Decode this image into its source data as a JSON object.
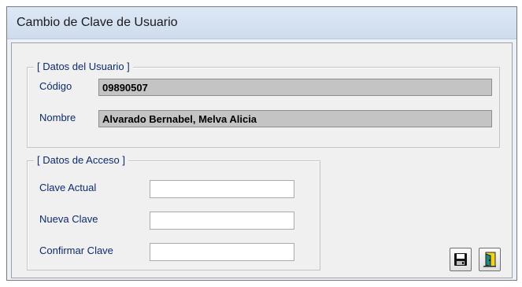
{
  "window": {
    "title": "Cambio de Clave de Usuario"
  },
  "user_section": {
    "legend": "[ Datos del Usuario ]",
    "code_label": "Código",
    "code_value": "09890507",
    "name_label": "Nombre",
    "name_value": "Alvarado Bernabel, Melva Alicia"
  },
  "access_section": {
    "legend": "[ Datos de Acceso ]",
    "current_password_label": "Clave Actual",
    "current_password_value": "",
    "new_password_label": "Nueva Clave",
    "new_password_value": "",
    "confirm_password_label": "Confirmar Clave",
    "confirm_password_value": ""
  },
  "buttons": {
    "save_icon": "floppy-disk-icon",
    "exit_icon": "exit-door-icon"
  },
  "colors": {
    "label_text": "#0d2a6e",
    "readonly_field_bg": "#c4c4c4",
    "form_bg": "#f0f0f0"
  }
}
